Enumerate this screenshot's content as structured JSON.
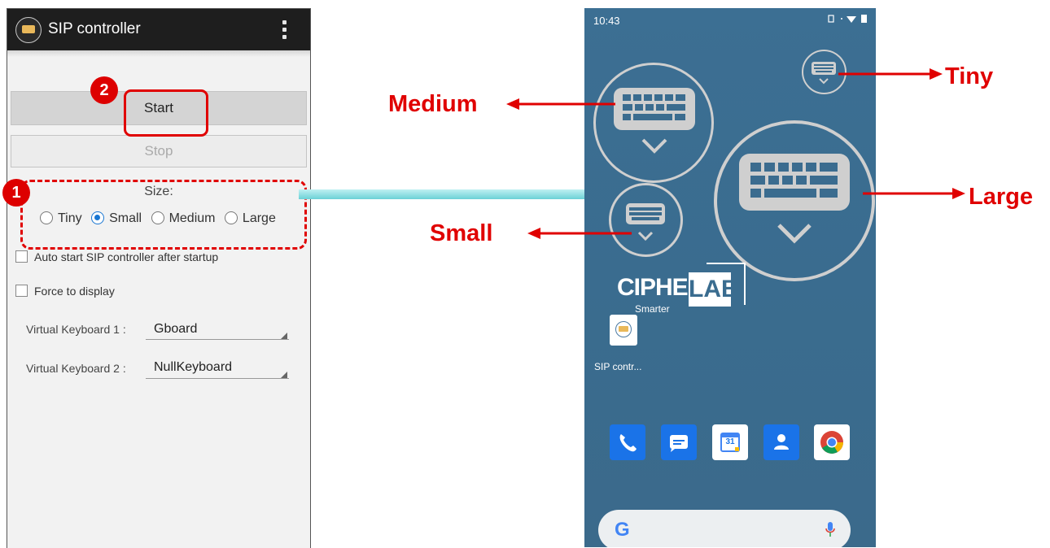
{
  "left_app": {
    "title": "SIP controller",
    "start_label": "Start",
    "stop_label": "Stop",
    "size_label": "Size:",
    "size_options": [
      "Tiny",
      "Small",
      "Medium",
      "Large"
    ],
    "selected_size": "Small",
    "auto_start_label": "Auto start SIP controller after startup",
    "force_display_label": "Force to display",
    "vk1_label": "Virtual Keyboard 1 :",
    "vk1_value": "Gboard",
    "vk2_label": "Virtual Keyboard 2 :",
    "vk2_value": "NullKeyboard",
    "auto_start_checked": false,
    "force_display_checked": false
  },
  "annotations": {
    "badge_1": "1",
    "badge_2": "2",
    "tag_medium": "Medium",
    "tag_tiny": "Tiny",
    "tag_large": "Large",
    "tag_small": "Small"
  },
  "right_phone": {
    "clock": "10:43",
    "logo_cipher": "CIPHER",
    "logo_lab": "LAB",
    "logo_tagline": "Smarter",
    "app_label": "SIP contr...",
    "calendar_day": "31",
    "search_g": "G"
  },
  "icons": [
    "keyboard-icon",
    "menu-dots-icon",
    "phone-icon",
    "messages-icon",
    "calendar-icon",
    "contacts-icon",
    "chrome-icon",
    "mic-icon"
  ],
  "colors": {
    "annotation_red": "#e00000",
    "appbar": "#1e1e1e",
    "radio_accent": "#1976d2",
    "wallpaper": "#3b6c8f",
    "connector": "#6bd1d6"
  }
}
